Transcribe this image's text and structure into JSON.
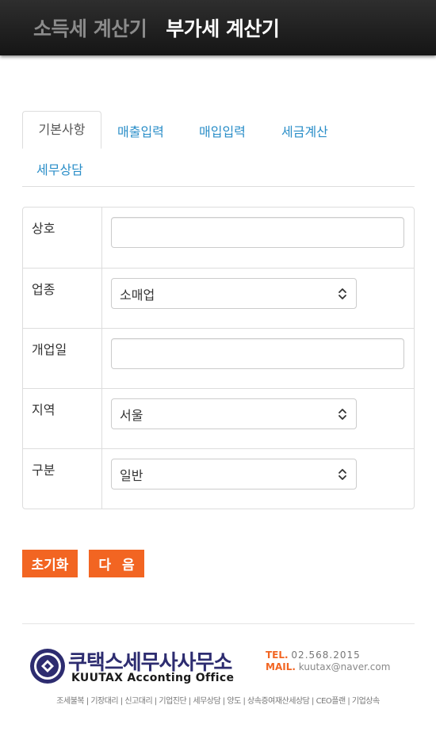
{
  "topbar": {
    "nav_income_tax": "소득세 계산기",
    "nav_vat": "부가세 계산기"
  },
  "tabs": [
    {
      "label": "기본사항",
      "active": true
    },
    {
      "label": "매출입력",
      "active": false
    },
    {
      "label": "매입입력",
      "active": false
    },
    {
      "label": "세금계산",
      "active": false
    },
    {
      "label": "세무상담",
      "active": false
    }
  ],
  "form": {
    "company": {
      "label": "상호",
      "value": ""
    },
    "industry": {
      "label": "업종",
      "selected": "소매업"
    },
    "open_date": {
      "label": "개업일",
      "value": ""
    },
    "region": {
      "label": "지역",
      "selected": "서울"
    },
    "category": {
      "label": "구분",
      "selected": "일반"
    }
  },
  "buttons": {
    "reset": "초기화",
    "next": "다 음"
  },
  "footer": {
    "brand_ko": "쿠택스세무사사무소",
    "brand_en": "KUUTAX Acconting Office",
    "tel_label": "TEL.",
    "tel": "02.568.2015",
    "mail_label": "MAIL.",
    "mail": "kuutax@naver.com",
    "menu": "조세불복 | 기장대리 | 신고대리 | 기업진단 | 세무상담 | 양도 | 상속증여재산세상담 | CEO플랜 | 기업상속"
  },
  "colors": {
    "accent": "#f26522",
    "link": "#2a8ec8",
    "brand": "#2d2c70"
  }
}
